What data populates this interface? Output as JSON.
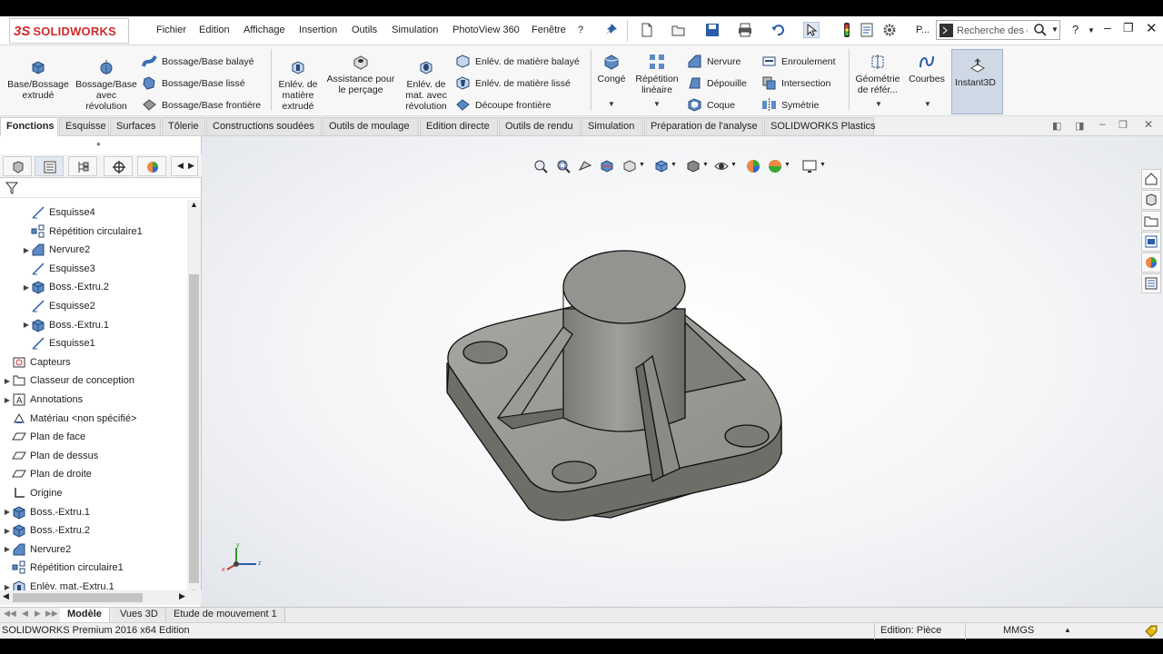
{
  "app": {
    "logo_ds": "3S",
    "logo_name": "SOLIDWORKS"
  },
  "menu": [
    "Fichier",
    "Edition",
    "Affichage",
    "Insertion",
    "Outils",
    "Simulation",
    "PhotoView 360",
    "Fenêtre",
    "?"
  ],
  "toolbar": {
    "p_label": "P...",
    "search_placeholder": "Recherche des c",
    "help_label": "?"
  },
  "ribbon": {
    "base_extrude": "Base/Bossage extrudé",
    "base_revolve": "Bossage/Base avec révolution",
    "swept": "Bossage/Base balayé",
    "loft": "Bossage/Base lissé",
    "boundary": "Bossage/Base frontière",
    "cut_extrude": "Enlév. de matière extrudé",
    "hole_wizard": "Assistance pour le perçage",
    "cut_revolve": "Enlév. de mat. avec révolution",
    "swept_cut": "Enlév. de matière balayé",
    "lofted_cut": "Enlév. de matière lissé",
    "boundary_cut": "Découpe frontière",
    "fillet": "Congé",
    "linear_pattern": "Répétition linéaire",
    "rib": "Nervure",
    "draft": "Dépouille",
    "shell": "Coque",
    "wrap": "Enroulement",
    "intersect": "Intersection",
    "mirror": "Symétrie",
    "ref_geometry": "Géométrie de référ...",
    "curves": "Courbes",
    "instant3d": "Instant3D"
  },
  "tabs": [
    "Fonctions",
    "Esquisse",
    "Surfaces",
    "Tôlerie",
    "Constructions soudées",
    "Outils de moulage",
    "Edition directe",
    "Outils de rendu",
    "Simulation",
    "Préparation de l'analyse",
    "SOLIDWORKS Plastics"
  ],
  "tree": [
    {
      "label": "Esquisse4",
      "indent": 1,
      "expand": false,
      "icon": "sketch"
    },
    {
      "label": "Répétition circulaire1",
      "indent": 1,
      "expand": false,
      "icon": "pattern"
    },
    {
      "label": "Nervure2",
      "indent": 1,
      "expand": true,
      "icon": "rib"
    },
    {
      "label": "Esquisse3",
      "indent": 1,
      "expand": false,
      "icon": "sketch"
    },
    {
      "label": "Boss.-Extru.2",
      "indent": 1,
      "expand": true,
      "icon": "extrude"
    },
    {
      "label": "Esquisse2",
      "indent": 1,
      "expand": false,
      "icon": "sketch"
    },
    {
      "label": "Boss.-Extru.1",
      "indent": 1,
      "expand": true,
      "icon": "extrude"
    },
    {
      "label": "Esquisse1",
      "indent": 1,
      "expand": false,
      "icon": "sketch"
    },
    {
      "label": "Capteurs",
      "indent": 0,
      "expand": false,
      "icon": "sensor"
    },
    {
      "label": "Classeur de conception",
      "indent": 0,
      "expand": true,
      "icon": "binder"
    },
    {
      "label": "Annotations",
      "indent": 0,
      "expand": true,
      "icon": "annot"
    },
    {
      "label": "Matériau <non spécifié>",
      "indent": 0,
      "expand": false,
      "icon": "material"
    },
    {
      "label": "Plan de face",
      "indent": 0,
      "expand": false,
      "icon": "plane"
    },
    {
      "label": "Plan de dessus",
      "indent": 0,
      "expand": false,
      "icon": "plane"
    },
    {
      "label": "Plan de droite",
      "indent": 0,
      "expand": false,
      "icon": "plane"
    },
    {
      "label": "Origine",
      "indent": 0,
      "expand": false,
      "icon": "origin"
    },
    {
      "label": "Boss.-Extru.1",
      "indent": 0,
      "expand": true,
      "icon": "extrude"
    },
    {
      "label": "Boss.-Extru.2",
      "indent": 0,
      "expand": true,
      "icon": "extrude"
    },
    {
      "label": "Nervure2",
      "indent": 0,
      "expand": true,
      "icon": "rib"
    },
    {
      "label": "Répétition circulaire1",
      "indent": 0,
      "expand": false,
      "icon": "pattern"
    },
    {
      "label": "Enlèv. mat.-Extru.1",
      "indent": 0,
      "expand": true,
      "icon": "cut"
    }
  ],
  "bottom_tabs": [
    "Modèle",
    "Vues 3D",
    "Etude de mouvement 1"
  ],
  "status": {
    "edition": "SOLIDWORKS Premium 2016 x64 Edition",
    "mode": "Edition: Pièce",
    "units": "MMGS"
  },
  "triad": {
    "x": "x",
    "y": "y",
    "z": "z"
  },
  "colors": {
    "accent": "#d02b2b",
    "part": "#8f8d88"
  }
}
